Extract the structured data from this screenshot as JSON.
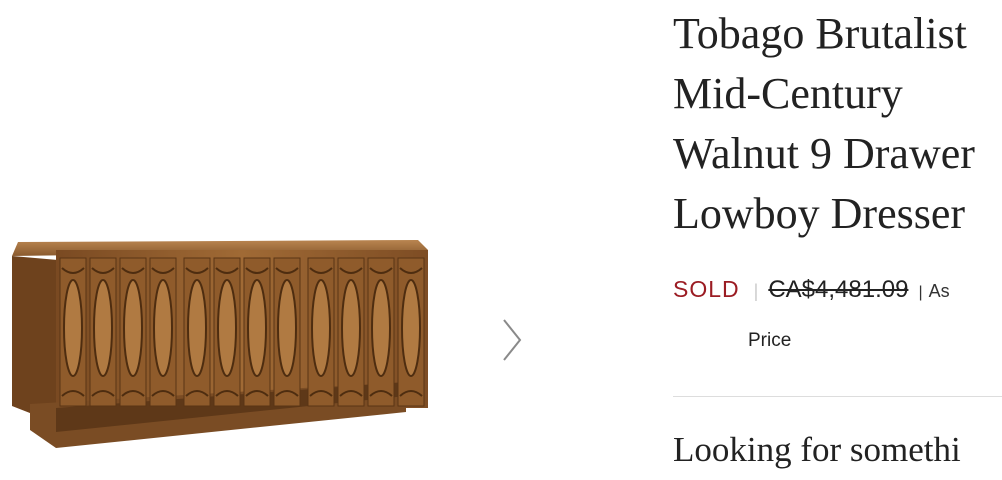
{
  "product": {
    "title": "Tobago Brutalist Mid-Century Walnut 9 Drawer Lowboy Dresser",
    "image_alt": "Walnut brutalist lowboy dresser"
  },
  "pricing": {
    "status": "SOLD",
    "separator": "|",
    "original_price": "CA$4,481.09",
    "note_separator": "|",
    "note_fragment": "As",
    "price_label": "Price"
  },
  "section": {
    "looking_heading": "Looking for somethi"
  },
  "gallery": {
    "next_icon": "chevron-right-icon"
  },
  "colors": {
    "sold": "#9b1c23",
    "wood": "#8a5a2e",
    "divider": "#dddddd"
  }
}
